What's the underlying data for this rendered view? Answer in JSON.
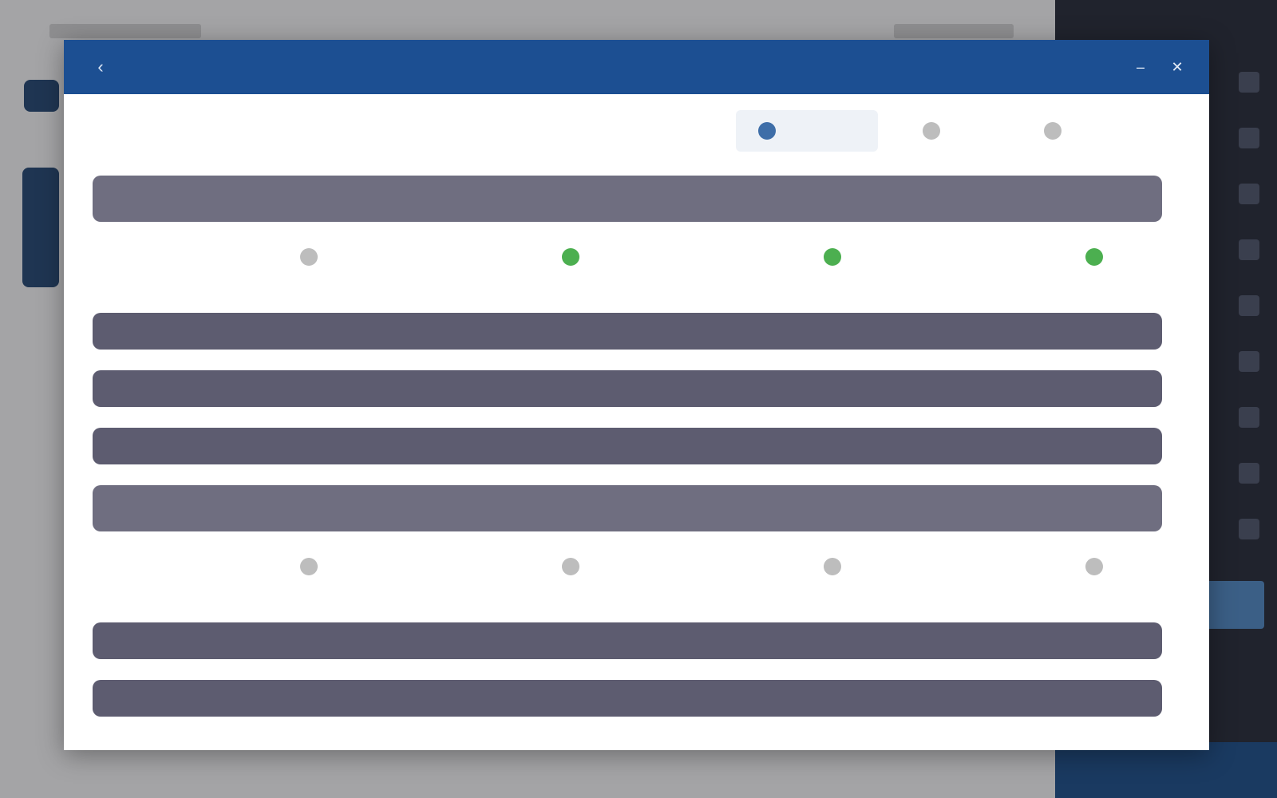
{
  "window": {
    "title": "",
    "header_link": "",
    "back_icon": "arrow-left-icon",
    "minimize_icon": "minimize-icon",
    "close_icon": "close-icon"
  },
  "filters": [
    {
      "label": "",
      "active": true
    },
    {
      "label": "",
      "active": false
    },
    {
      "label": "",
      "active": false
    }
  ],
  "groups": [
    {
      "rows": [
        {
          "label": "",
          "meta": ""
        }
      ],
      "statuses": [
        {
          "label": "",
          "state": "neutral"
        },
        {
          "label": "",
          "state": "ok"
        },
        {
          "label": "",
          "state": "ok"
        },
        {
          "label": "",
          "state": "ok"
        }
      ]
    },
    {
      "rows": [
        {
          "label": "",
          "meta": ""
        },
        {
          "label": "",
          "meta": ""
        },
        {
          "label": "",
          "meta": ""
        },
        {
          "label": "",
          "meta": ""
        }
      ],
      "statuses": [
        {
          "label": "",
          "state": "neutral"
        },
        {
          "label": "",
          "state": "neutral"
        },
        {
          "label": "",
          "state": "neutral"
        },
        {
          "label": "",
          "state": "neutral"
        }
      ]
    },
    {
      "rows": [
        {
          "label": "",
          "meta": ""
        },
        {
          "label": "",
          "meta": ""
        }
      ]
    }
  ],
  "colors": {
    "header": "#1c4f92",
    "row": "#5d5c70",
    "status_ok": "#4caf50",
    "status_neutral": "#bdbdbd"
  }
}
